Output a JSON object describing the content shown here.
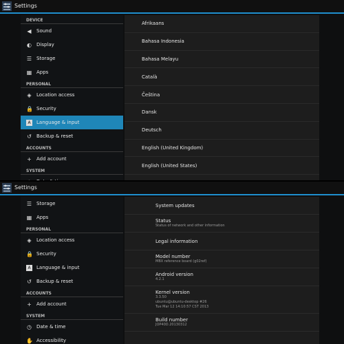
{
  "app_title": "Settings",
  "top": {
    "sidebar": [
      {
        "kind": "header",
        "label": "DEVICE"
      },
      {
        "kind": "item",
        "label": "Sound",
        "icon": "speaker-icon"
      },
      {
        "kind": "item",
        "label": "Display",
        "icon": "brightness-icon"
      },
      {
        "kind": "item",
        "label": "Storage",
        "icon": "storage-icon"
      },
      {
        "kind": "item",
        "label": "Apps",
        "icon": "apps-icon"
      },
      {
        "kind": "header",
        "label": "PERSONAL"
      },
      {
        "kind": "item",
        "label": "Location access",
        "icon": "location-icon"
      },
      {
        "kind": "item",
        "label": "Security",
        "icon": "lock-icon"
      },
      {
        "kind": "item",
        "label": "Language & input",
        "icon": "keyboard-icon",
        "selected": true
      },
      {
        "kind": "item",
        "label": "Backup & reset",
        "icon": "backup-icon"
      },
      {
        "kind": "header",
        "label": "ACCOUNTS"
      },
      {
        "kind": "item",
        "label": "Add account",
        "icon": "plus-icon"
      },
      {
        "kind": "header",
        "label": "SYSTEM"
      },
      {
        "kind": "item",
        "label": "Date & time",
        "icon": "clock-icon"
      }
    ],
    "languages": [
      "Afrikaans",
      "Bahasa Indonesia",
      "Bahasa Melayu",
      "Català",
      "Čeština",
      "Dansk",
      "Deutsch",
      "English (United Kingdom)",
      "English (United States)"
    ]
  },
  "bottom": {
    "sidebar": [
      {
        "kind": "item",
        "label": "Storage",
        "icon": "storage-icon"
      },
      {
        "kind": "item",
        "label": "Apps",
        "icon": "apps-icon"
      },
      {
        "kind": "header",
        "label": "PERSONAL"
      },
      {
        "kind": "item",
        "label": "Location access",
        "icon": "location-icon"
      },
      {
        "kind": "item",
        "label": "Security",
        "icon": "lock-icon"
      },
      {
        "kind": "item",
        "label": "Language & input",
        "icon": "keyboard-icon"
      },
      {
        "kind": "item",
        "label": "Backup & reset",
        "icon": "backup-icon"
      },
      {
        "kind": "header",
        "label": "ACCOUNTS"
      },
      {
        "kind": "item",
        "label": "Add account",
        "icon": "plus-icon"
      },
      {
        "kind": "header",
        "label": "SYSTEM"
      },
      {
        "kind": "item",
        "label": "Date & time",
        "icon": "clock-icon"
      },
      {
        "kind": "item",
        "label": "Accessibility",
        "icon": "hand-icon"
      }
    ],
    "about": [
      {
        "title": "System updates",
        "lines": []
      },
      {
        "title": "Status",
        "lines": [
          "Status of network and other information"
        ]
      },
      {
        "title": "Legal information",
        "lines": []
      },
      {
        "title": "Model number",
        "lines": [
          "MBX reference board (g02ref)"
        ]
      },
      {
        "title": "Android version",
        "lines": [
          "4.2.1"
        ]
      },
      {
        "title": "Kernel version",
        "lines": [
          "3.3.50",
          "ubuntu@ubuntu-desktop #26",
          "Tue Mar 12 14:10:57 CST 2013"
        ]
      },
      {
        "title": "Build number",
        "lines": [
          "JOP40D.20130312"
        ]
      }
    ]
  },
  "colors": {
    "accent": "#1f8fcf",
    "selected": "#1f86b8"
  }
}
